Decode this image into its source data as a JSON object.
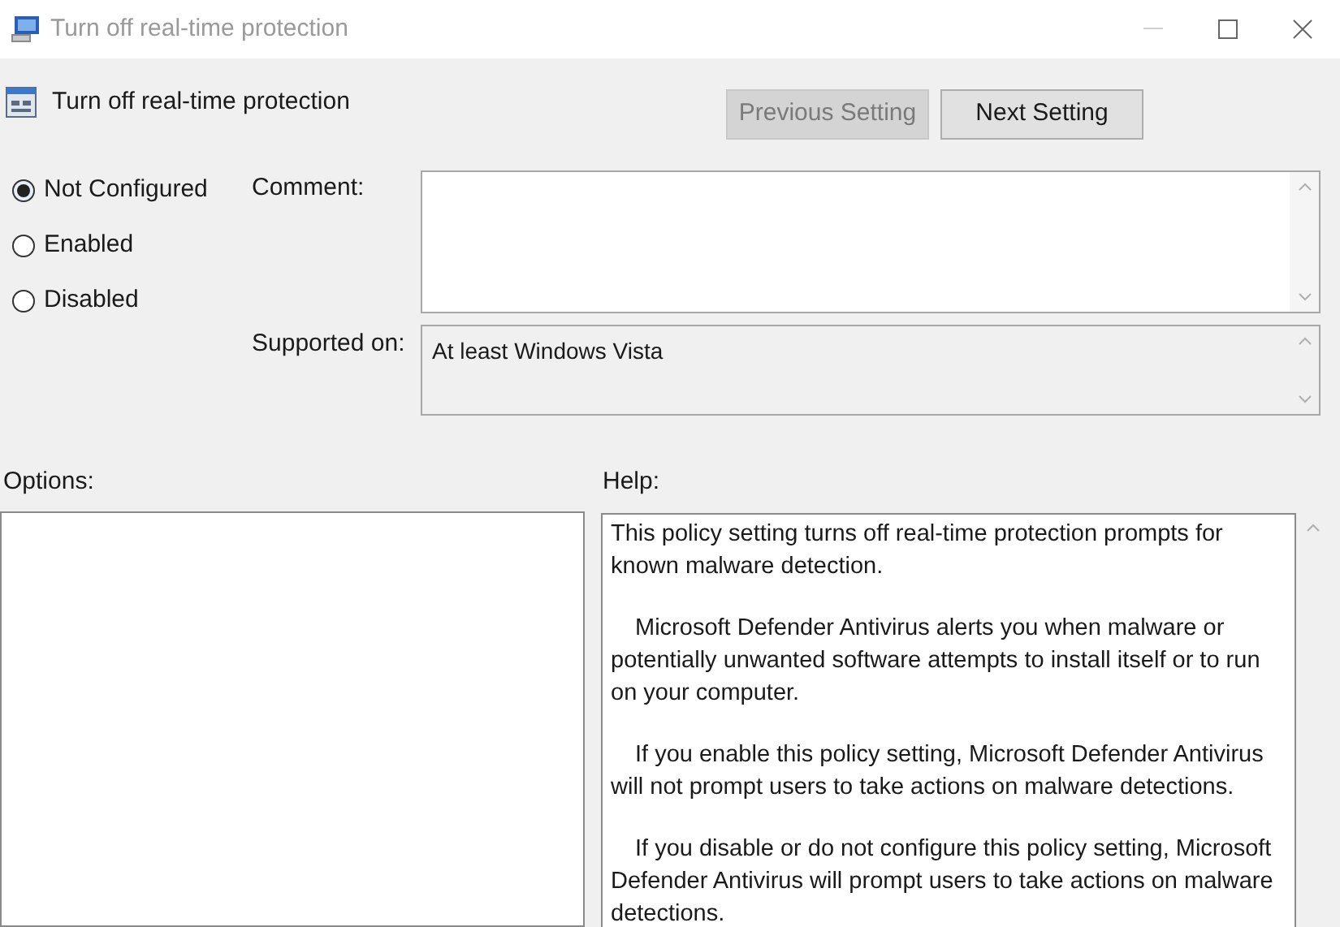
{
  "window": {
    "title": "Turn off real-time protection"
  },
  "header": {
    "title": "Turn off real-time protection"
  },
  "buttons": [
    {
      "label": "Previous Setting",
      "disabled": true
    },
    {
      "label": "Next Setting",
      "disabled": false
    }
  ],
  "options": [
    {
      "label": "Not Configured",
      "selected": true
    },
    {
      "label": "Enabled",
      "selected": false
    },
    {
      "label": "Disabled",
      "selected": false
    }
  ],
  "comment": {
    "label": "Comment:"
  },
  "supported_on": {
    "label": "Supported on:",
    "value": "At least Windows Vista"
  },
  "options_label": "Options:",
  "help": {
    "label": "Help:",
    "paragraphs": [
      "This policy setting turns off real-time protection prompts for known malware detection.",
      "Microsoft Defender Antivirus alerts you when malware or potentially unwanted software attempts to install itself or to run on your computer.",
      "If you enable this policy setting, Microsoft Defender Antivirus will not prompt users to take actions on malware detections.",
      "If you disable or do not configure this policy setting, Microsoft Defender Antivirus will prompt users to take actions on malware detections."
    ]
  }
}
